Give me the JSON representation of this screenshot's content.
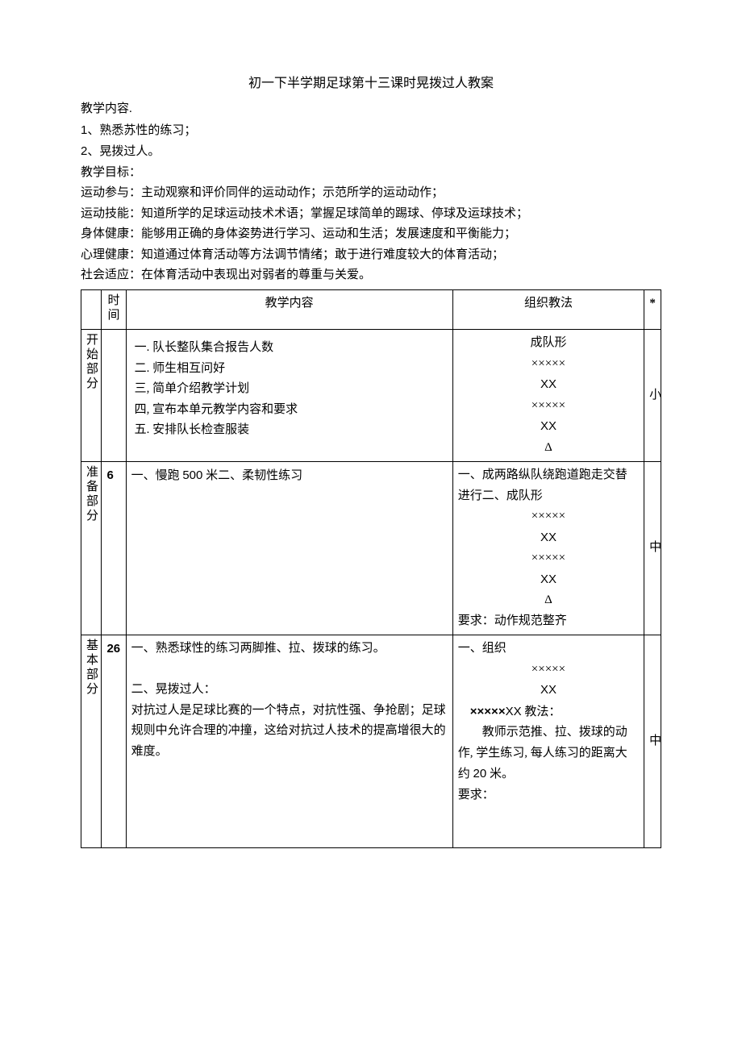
{
  "title": "初一下半学期足球第十三课时晃拨过人教案",
  "header": {
    "content_label": "教学内容.",
    "item1": "1、熟悉苏性的练习；",
    "item2": "2、晃拨过人。",
    "goal_label": "教学目标：",
    "g1": "运动参与：主动观察和评价同伴的运动动作；示范所学的运动动作；",
    "g2": "运动技能：知道所学的足球运动技术术语；掌握足球简单的踢球、停球及运球技术；",
    "g3": "身体健康：能够用正确的身体姿势进行学习、运动和生活；发展速度和平衡能力；",
    "g4": "心理健康：知道通过体育活动等方法调节情绪；敢于进行难度较大的体育活动；",
    "g5": "社会适应：在体育活动中表现出对弱者的尊重与关爱。"
  },
  "thead": {
    "c1": "",
    "c2": "时间",
    "c3": "教学内容",
    "c4": "组织教法",
    "c5": "*"
  },
  "rows": {
    "r1": {
      "section": "开始部分",
      "time": "",
      "content_l1": "一. 队长整队集合报告人数",
      "content_l2": "二. 师生相互问好",
      "content_l3": "三, 简单介绍教学计划",
      "content_l4": "四, 宣布本单元教学内容和要求",
      "content_l5": "五. 安排队长检查服装",
      "method_l1": "成队形",
      "method_l2": "×××××",
      "method_l3": "XX",
      "method_l4": "×××××",
      "method_l5": "XX",
      "method_l6": "Δ",
      "last": "小"
    },
    "r2": {
      "section": "准备部分",
      "time": "6",
      "content_l1_a": "一、慢跑 ",
      "content_l1_b": "500",
      "content_l1_c": " 米二、柔韧性练习",
      "method_l1": "一、成两路纵队绕跑道跑走交替进行二、成队形",
      "method_l2": "×××××",
      "method_l3": "XX",
      "method_l4": "×××××",
      "method_l5": "XX",
      "method_l6": "Δ",
      "method_l7": "要求：动作规范整齐",
      "last": "中"
    },
    "r3": {
      "section": "基本部分",
      "time": "26",
      "content_l1": "一、熟悉球性的练习两脚推、拉、拨球的练习。",
      "content_l2": "二、晃拨过人：",
      "content_l3": "对抗过人是足球比赛的一个特点，对抗性强、争抢剧；足球规则中允许合理的冲撞，这给对抗过人技术的提高增很大的难度。",
      "method_l1": "一、组织",
      "method_l2": "×××××",
      "method_l3": "XX",
      "method_l4a": "×××××",
      "method_l4b": "XX",
      "method_l4c": " 教法：",
      "method_l5a": "　　教师示范推、拉、拨球的动作, 学生练习, 每人练习的距离大约 ",
      "method_l5b": "20",
      "method_l5c": " 米。",
      "method_l6": "要求：",
      "last": "中"
    }
  }
}
